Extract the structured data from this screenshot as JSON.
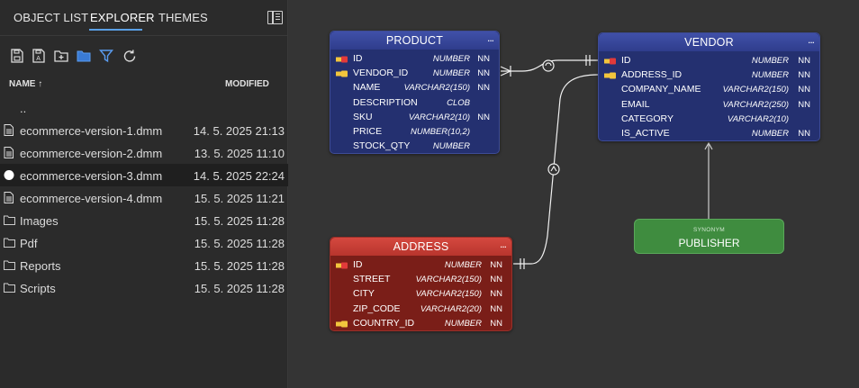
{
  "tabs": [
    {
      "label": "OBJECT LIST"
    },
    {
      "label": "EXPLORER"
    },
    {
      "label": "THEMES"
    }
  ],
  "columns": {
    "name": "NAME ↑",
    "modified": "MODIFIED"
  },
  "files": [
    {
      "name": "..",
      "date": "",
      "icon": "folder-up-icon"
    },
    {
      "name": "ecommerce-version-1.dmm",
      "date": "14. 5. 2025 21:13",
      "icon": "file-icon"
    },
    {
      "name": "ecommerce-version-2.dmm",
      "date": "13. 5. 2025 11:10",
      "icon": "file-icon"
    },
    {
      "name": "ecommerce-version-3.dmm",
      "date": "14. 5. 2025 22:24",
      "icon": "open-file-dot-icon"
    },
    {
      "name": "ecommerce-version-4.dmm",
      "date": "15. 5. 2025 11:21",
      "icon": "file-icon"
    },
    {
      "name": "Images",
      "date": "15. 5. 2025 11:28",
      "icon": "folder-icon"
    },
    {
      "name": "Pdf",
      "date": "15. 5. 2025 11:28",
      "icon": "folder-icon"
    },
    {
      "name": "Reports",
      "date": "15. 5. 2025 11:28",
      "icon": "folder-icon"
    },
    {
      "name": "Scripts",
      "date": "15. 5. 2025 11:28",
      "icon": "folder-icon"
    }
  ],
  "entities": {
    "product": {
      "title": "PRODUCT",
      "menu": "...",
      "attrs": [
        {
          "name": "ID",
          "type": "NUMBER",
          "nn": "NN",
          "key": "pk"
        },
        {
          "name": "VENDOR_ID",
          "type": "NUMBER",
          "nn": "NN",
          "key": "fk"
        },
        {
          "name": "NAME",
          "type": "VARCHAR2(150)",
          "nn": "NN",
          "key": ""
        },
        {
          "name": "DESCRIPTION",
          "type": "CLOB",
          "nn": "",
          "key": ""
        },
        {
          "name": "SKU",
          "type": "VARCHAR2(10)",
          "nn": "NN",
          "key": ""
        },
        {
          "name": "PRICE",
          "type": "NUMBER(10,2)",
          "nn": "",
          "key": ""
        },
        {
          "name": "STOCK_QTY",
          "type": "NUMBER",
          "nn": "",
          "key": ""
        }
      ]
    },
    "vendor": {
      "title": "VENDOR",
      "menu": "...",
      "attrs": [
        {
          "name": "ID",
          "type": "NUMBER",
          "nn": "NN",
          "key": "pk"
        },
        {
          "name": "ADDRESS_ID",
          "type": "NUMBER",
          "nn": "NN",
          "key": "fk"
        },
        {
          "name": "COMPANY_NAME",
          "type": "VARCHAR2(150)",
          "nn": "NN",
          "key": ""
        },
        {
          "name": "EMAIL",
          "type": "VARCHAR2(250)",
          "nn": "NN",
          "key": ""
        },
        {
          "name": "CATEGORY",
          "type": "VARCHAR2(10)",
          "nn": "",
          "key": ""
        },
        {
          "name": "IS_ACTIVE",
          "type": "NUMBER",
          "nn": "NN",
          "key": ""
        }
      ]
    },
    "address": {
      "title": "ADDRESS",
      "menu": "...",
      "attrs": [
        {
          "name": "ID",
          "type": "NUMBER",
          "nn": "NN",
          "key": "pk"
        },
        {
          "name": "STREET",
          "type": "VARCHAR2(150)",
          "nn": "NN",
          "key": ""
        },
        {
          "name": "CITY",
          "type": "VARCHAR2(150)",
          "nn": "NN",
          "key": ""
        },
        {
          "name": "ZIP_CODE",
          "type": "VARCHAR2(20)",
          "nn": "NN",
          "key": ""
        },
        {
          "name": "COUNTRY_ID",
          "type": "NUMBER",
          "nn": "NN",
          "key": "fk"
        }
      ]
    }
  },
  "synonym": {
    "label": "SYNONYM",
    "name": "PUBLISHER"
  },
  "colors": {
    "accent": "#5aa0e6",
    "blue_entity": "#243070",
    "red_entity": "#7a1e18",
    "green_synonym": "#3f8c3f"
  }
}
